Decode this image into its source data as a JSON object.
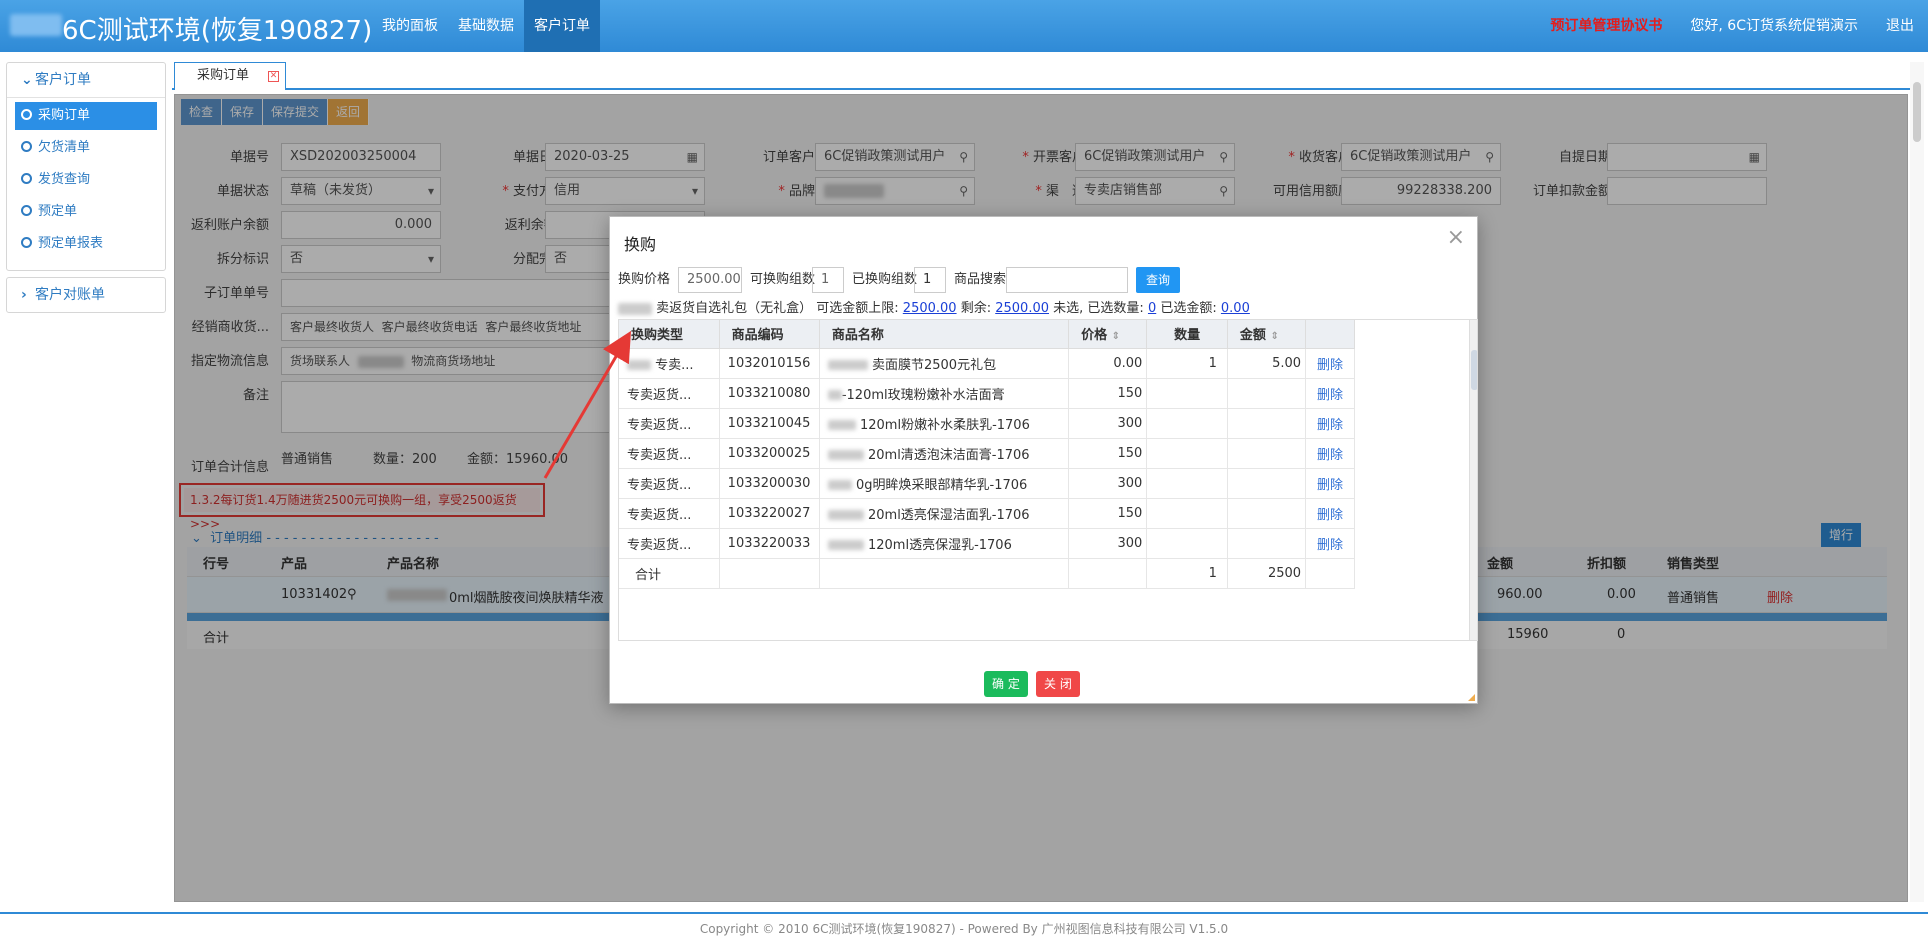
{
  "app": {
    "title": "6C测试环境(恢复190827)",
    "nav": [
      "我的面板",
      "基础数据",
      "客户订单"
    ],
    "active_nav": "客户订单",
    "agreement_link": "预订单管理协议书",
    "greeting": "您好, 6C订货系统促销演示",
    "logout": "退出"
  },
  "sidebar": {
    "groups": [
      {
        "label": "客户订单",
        "items": [
          "采购订单",
          "欠货清单",
          "发货查询",
          "预定单",
          "预定单报表"
        ]
      },
      {
        "label": "客户对账单"
      }
    ],
    "active_item": "采购订单"
  },
  "tab": {
    "label": "采购订单"
  },
  "toolbar": {
    "check": "检查",
    "save": "保存",
    "save_submit": "保存提交",
    "back": "返回"
  },
  "form": {
    "order_no_label": "单据号",
    "order_no": "XSD202003250004",
    "order_date_label": "单据日期",
    "order_date": "2020-03-25",
    "order_customer_label": "订单客户",
    "order_customer": "6C促销政策测试用户",
    "invoice_customer_label": "开票客户",
    "invoice_customer": "6C促销政策测试用户",
    "receive_customer_label": "收货客户",
    "receive_customer": "6C促销政策测试用户",
    "pickup_date_label": "自提日期",
    "status_label": "单据状态",
    "status": "草稿（未发货）",
    "pay_label": "支付方式",
    "pay": "信用",
    "brand_label": "品牌",
    "channel_label": "渠　道",
    "channel": "专卖店销售部",
    "credit_label": "可用信用额度",
    "credit": "99228338.200",
    "deduct_label": "订单扣款金额",
    "rebate_balance_label": "返利账户余额",
    "rebate_balance": "0.000",
    "rebate2_label": "返利余额2",
    "split_label": "拆分标识",
    "split": "否",
    "dist_label": "分配完成",
    "dist": "否",
    "sub_order_label": "子订单单号",
    "dealer_label": "经销商收货...",
    "dealer_receiver": "客户最终收货人",
    "dealer_phone": "客户最终收货电话",
    "dealer_addr": "客户最终收货地址",
    "logistics_label": "指定物流信息",
    "logistics_contact": "货场联系人",
    "logistics_addr": "物流商货场地址",
    "remark_label": "备注",
    "summary_label": "订单合计信息",
    "summary_type": "普通销售",
    "summary_qty": "数量：200",
    "summary_amount": "金额：15960.00"
  },
  "promo": {
    "text": "1.3.2每订货1.4万随进货2500元可换购一组，享受2500返货>>>"
  },
  "detail": {
    "title": "订单明细",
    "add_row": "增行",
    "headers": [
      "行号",
      "产品",
      "产品名称"
    ],
    "right_headers": [
      "金额",
      "折扣额",
      "销售类型"
    ],
    "row": {
      "product": "10331402",
      "name": "0ml烟酰胺夜间焕肤精华液",
      "amount": "960.00",
      "discount": "0.00",
      "type": "普通销售",
      "delete": "删除"
    },
    "total_label": "合计",
    "total_amount": "15960",
    "total_discount": "0"
  },
  "modal": {
    "title": "换购",
    "price_label": "换购价格",
    "price": "2500.00",
    "groups_label": "可换购组数",
    "groups": "1",
    "bought_label": "已换购组数",
    "bought": "1",
    "search_label": "商品搜索",
    "query": "查询",
    "info_prefix": "卖返货自选礼包（无礼盒）  可选金额上限:",
    "limit": "2500.00",
    "remain_label": "剩余:",
    "remain": "2500.00",
    "unselected": "未选,",
    "selected_qty_label": "已选数量:",
    "selected_qty": "0",
    "selected_amt_label": "已选金额:",
    "selected_amt": "0.00",
    "headers": [
      "换购类型",
      "商品编码",
      "商品名称",
      "价格",
      "数量",
      "金额"
    ],
    "rows": [
      {
        "type": "专卖...",
        "code": "1032010156",
        "name": "卖面膜节2500元礼包",
        "price": "0.00",
        "qty": "1",
        "amount": "5.00",
        "del": "删除"
      },
      {
        "type": "专卖返货...",
        "code": "1033210080",
        "name": "-120ml玫瑰粉嫩补水洁面膏",
        "price": "150",
        "qty": "",
        "amount": "",
        "del": "删除"
      },
      {
        "type": "专卖返货...",
        "code": "1033210045",
        "name": "120ml粉嫩补水柔肤乳-1706",
        "price": "300",
        "qty": "",
        "amount": "",
        "del": "删除"
      },
      {
        "type": "专卖返货...",
        "code": "1033200025",
        "name": "20ml清透泡沫洁面膏-1706",
        "price": "150",
        "qty": "",
        "amount": "",
        "del": "删除"
      },
      {
        "type": "专卖返货...",
        "code": "1033200030",
        "name": "0g明眸焕采眼部精华乳-1706",
        "price": "300",
        "qty": "",
        "amount": "",
        "del": "删除"
      },
      {
        "type": "专卖返货...",
        "code": "1033220027",
        "name": "20ml透亮保湿洁面乳-1706",
        "price": "150",
        "qty": "",
        "amount": "",
        "del": "删除"
      },
      {
        "type": "专卖返货...",
        "code": "1033220033",
        "name": "120ml透亮保湿乳-1706",
        "price": "300",
        "qty": "",
        "amount": "",
        "del": "删除"
      }
    ],
    "total_label": "合计",
    "total_qty": "1",
    "total_amount": "2500",
    "ok": "确 定",
    "close": "关 闭"
  },
  "footer": {
    "text": "Copyright © 2010 6C测试环境(恢复190827) - Powered By 广州视图信息科技有限公司 V1.5.0"
  }
}
